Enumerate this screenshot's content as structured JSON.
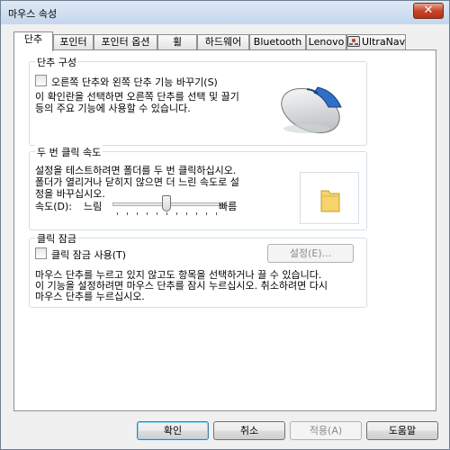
{
  "window": {
    "title": "마우스 속성"
  },
  "tabs": [
    {
      "label": "단추",
      "active": true
    },
    {
      "label": "포인터"
    },
    {
      "label": "포인터 옵션"
    },
    {
      "label": "휠"
    },
    {
      "label": "하드웨어"
    },
    {
      "label": "Bluetooth"
    },
    {
      "label": "Lenovo"
    },
    {
      "label": "UltraNav"
    }
  ],
  "button_config": {
    "title": "단추 구성",
    "swap_checkbox_label": "오른쪽 단추와 왼쪽 단추 기능 바꾸기(S)",
    "swap_checked": false,
    "description_line1": "이 확인란을 선택하면 오른쪽 단추를 선택 및 끌기",
    "description_line2": "등의 주요 기능에 사용할 수 있습니다."
  },
  "double_click": {
    "title": "두 번 클릭 속도",
    "description_line1": "설정을 테스트하려면 폴더를 두 번 클릭하십시오.",
    "description_line2": "폴더가 열리거나 닫히지 않으면 더 느린 속도로 설",
    "description_line3": "정을 바꾸십시오.",
    "speed_label": "속도(D):",
    "slow_label": "느림",
    "fast_label": "빠름",
    "speed_value": 0.5
  },
  "click_lock": {
    "title": "클릭 잠금",
    "checkbox_label": "클릭 잠금 사용(T)",
    "checked": false,
    "settings_button": "설정(E)...",
    "description_line1": "마우스 단추를 누르고 있지 않고도 항목을 선택하거나 끌 수 있습니다.",
    "description_line2": "이 기능을 설정하려면 마우스 단추를 잠시 누르십시오. 취소하려면 다시",
    "description_line3": "마우스 단추를 누르십시오."
  },
  "footer": {
    "ok": "확인",
    "cancel": "취소",
    "apply": "적용(A)",
    "help": "도움말"
  }
}
